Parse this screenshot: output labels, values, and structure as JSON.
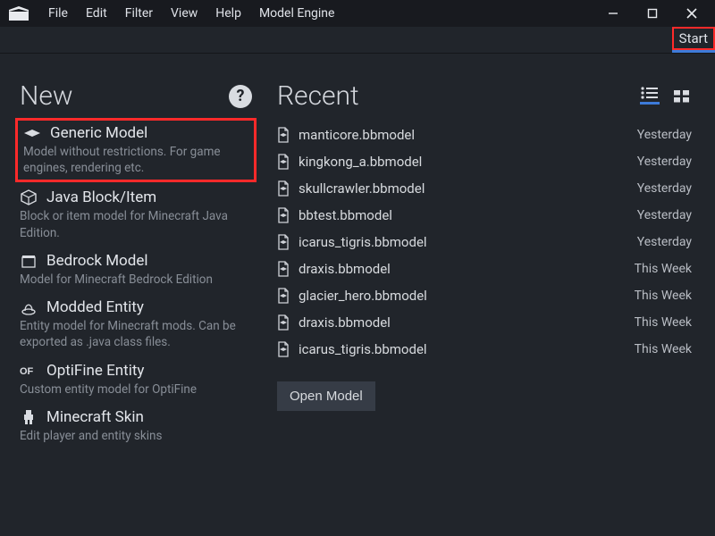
{
  "menu": [
    "File",
    "Edit",
    "Filter",
    "View",
    "Help",
    "Model Engine"
  ],
  "tab_start": "Start",
  "new": {
    "heading": "New",
    "items": [
      {
        "title": "Generic Model",
        "desc": "Model without restrictions. For game engines, rendering etc."
      },
      {
        "title": "Java Block/Item",
        "desc": "Block or item model for Minecraft Java Edition."
      },
      {
        "title": "Bedrock Model",
        "desc": "Model for Minecraft Bedrock Edition"
      },
      {
        "title": "Modded Entity",
        "desc": "Entity model for Minecraft mods. Can be exported as .java class files."
      },
      {
        "title": "OptiFine Entity",
        "desc": "Custom entity model for OptiFine"
      },
      {
        "title": "Minecraft Skin",
        "desc": "Edit player and entity skins"
      }
    ]
  },
  "recent": {
    "heading": "Recent",
    "files": [
      {
        "name": "manticore.bbmodel",
        "time": "Yesterday"
      },
      {
        "name": "kingkong_a.bbmodel",
        "time": "Yesterday"
      },
      {
        "name": "skullcrawler.bbmodel",
        "time": "Yesterday"
      },
      {
        "name": "bbtest.bbmodel",
        "time": "Yesterday"
      },
      {
        "name": "icarus_tigris.bbmodel",
        "time": "Yesterday"
      },
      {
        "name": "draxis.bbmodel",
        "time": "This Week"
      },
      {
        "name": "glacier_hero.bbmodel",
        "time": "This Week"
      },
      {
        "name": "draxis.bbmodel",
        "time": "This Week"
      },
      {
        "name": "icarus_tigris.bbmodel",
        "time": "This Week"
      }
    ],
    "open_button": "Open Model"
  }
}
